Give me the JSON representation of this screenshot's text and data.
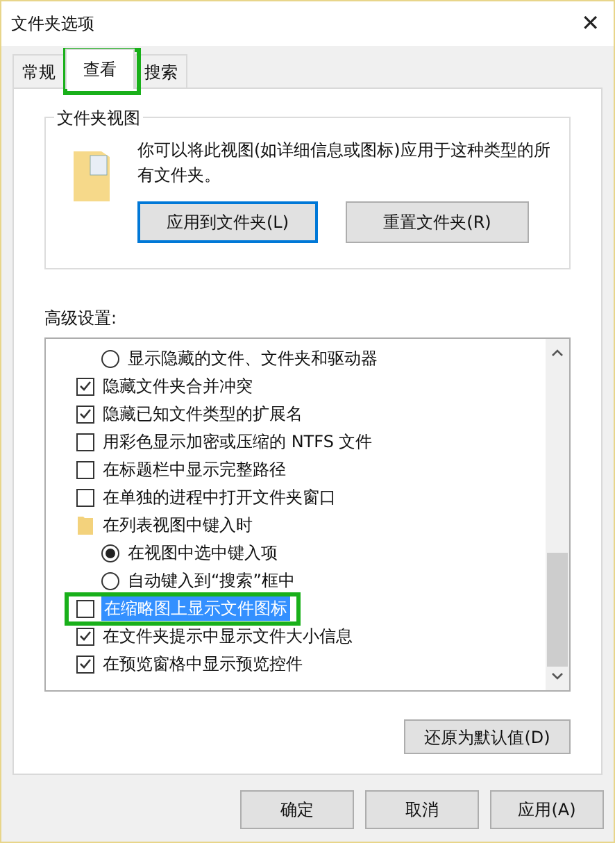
{
  "window": {
    "title": "文件夹选项",
    "close": "✕"
  },
  "tabs": [
    {
      "label": "常规",
      "selected": false
    },
    {
      "label": "查看",
      "selected": true
    },
    {
      "label": "搜索",
      "selected": false
    }
  ],
  "folder_views": {
    "title": "文件夹视图",
    "description": "你可以将此视图(如详细信息或图标)应用于这种类型的所有文件夹。",
    "buttons": [
      {
        "label": "应用到文件夹(L)",
        "primary": true
      },
      {
        "label": "重置文件夹(R)",
        "primary": false
      }
    ]
  },
  "advanced": {
    "label": "高级设置:",
    "items": [
      {
        "kind": "radio",
        "label": "显示隐藏的文件、文件夹和驱动器",
        "checked": false,
        "selected": false
      },
      {
        "kind": "checkbox",
        "label": "隐藏文件夹合并冲突",
        "checked": true,
        "selected": false
      },
      {
        "kind": "checkbox",
        "label": "隐藏已知文件类型的扩展名",
        "checked": true,
        "selected": false
      },
      {
        "kind": "checkbox",
        "label": "用彩色显示加密或压缩的 NTFS 文件",
        "checked": false,
        "selected": false
      },
      {
        "kind": "checkbox",
        "label": "在标题栏中显示完整路径",
        "checked": false,
        "selected": false
      },
      {
        "kind": "checkbox",
        "label": "在单独的进程中打开文件夹窗口",
        "checked": false,
        "selected": false
      },
      {
        "kind": "folder",
        "label": "在列表视图中键入时",
        "selected": false
      },
      {
        "kind": "radio",
        "label": "在视图中选中键入项",
        "checked": true,
        "selected": false
      },
      {
        "kind": "radio",
        "label": "自动键入到“搜索”框中",
        "checked": false,
        "selected": false
      },
      {
        "kind": "checkbox",
        "label": "在缩略图上显示文件图标",
        "checked": false,
        "selected": true
      },
      {
        "kind": "checkbox",
        "label": "在文件夹提示中显示文件大小信息",
        "checked": true,
        "selected": false
      },
      {
        "kind": "checkbox",
        "label": "在预览窗格中显示预览控件",
        "checked": true,
        "selected": false
      }
    ],
    "restore_button": "还原为默认值(D)"
  },
  "buttons": [
    "确定",
    "取消",
    "应用(A)"
  ]
}
